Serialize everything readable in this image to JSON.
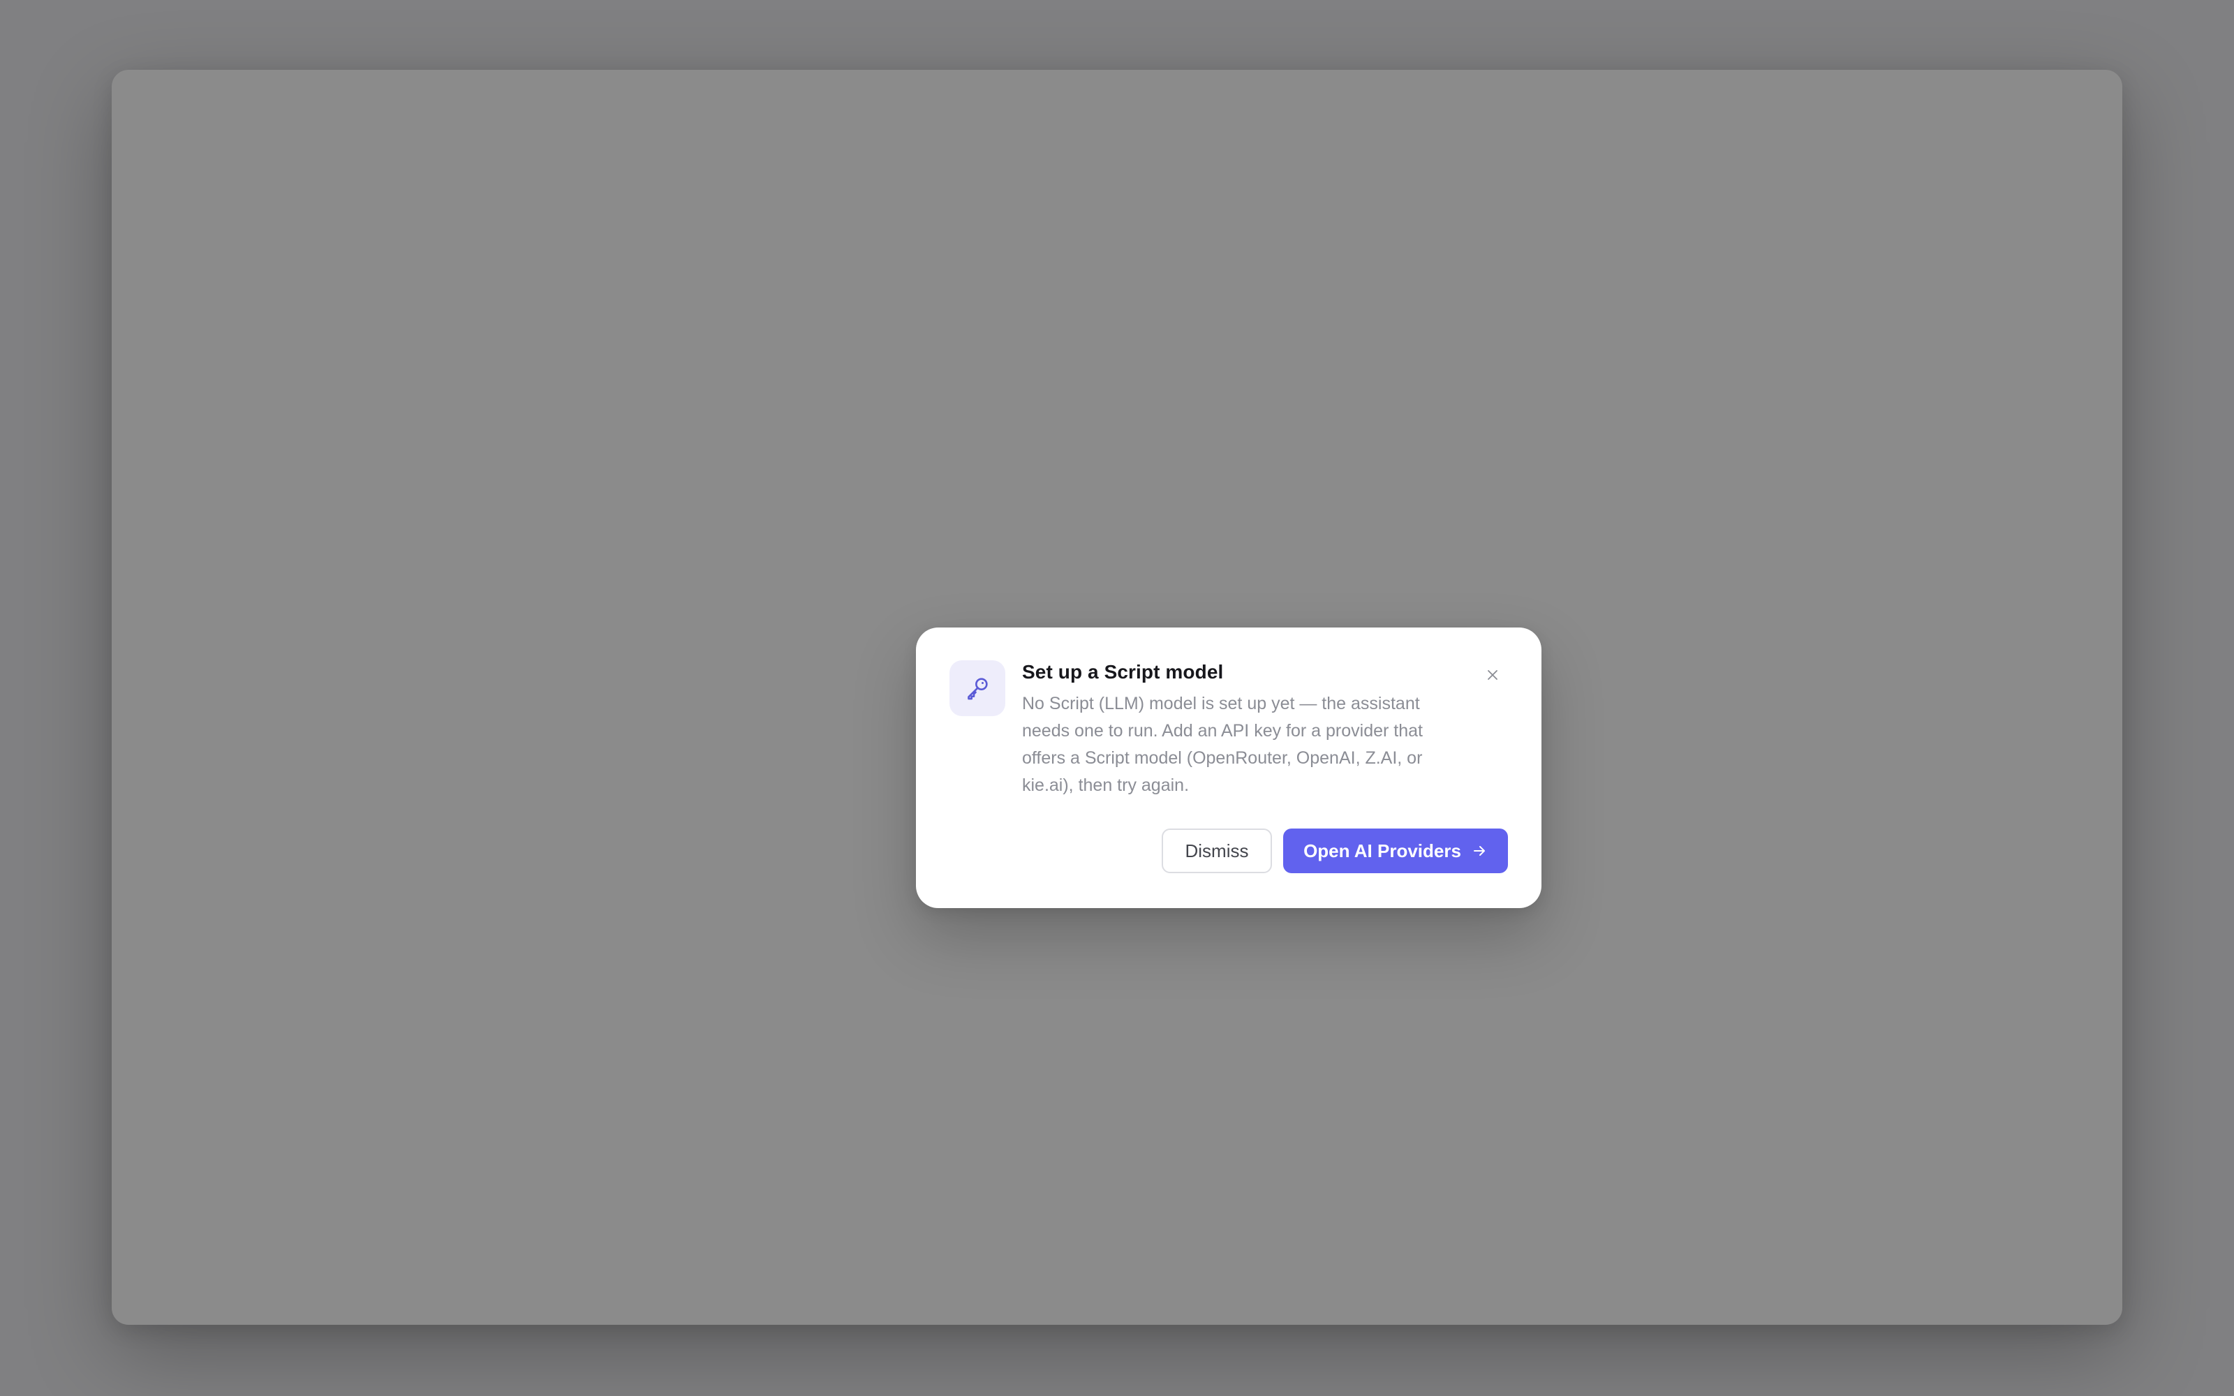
{
  "colors": {
    "backdrop": "#808082",
    "window": "#8b8b8b",
    "accent": "#6162ee",
    "icon_tile": "#eeedfb"
  },
  "dialog": {
    "icon": "key-icon",
    "title": "Set up a Script model",
    "message": "No Script (LLM) model is set up yet — the assistant needs one to run. Add an API key for a provider that offers a Script model (OpenRouter, OpenAI, Z.AI, or kie.ai), then try again.",
    "close_icon": "close-icon",
    "dismiss_label": "Dismiss",
    "primary_label": "Open AI Providers",
    "primary_icon": "arrow-right-icon"
  }
}
